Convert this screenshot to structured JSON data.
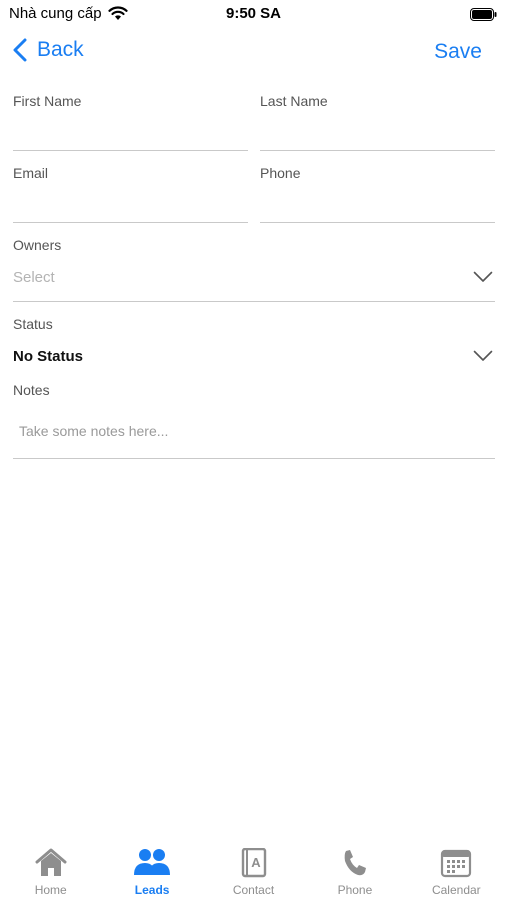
{
  "status_bar": {
    "carrier": "Nhà cung cấp",
    "time": "9:50 SA"
  },
  "nav": {
    "back_label": "Back",
    "save_label": "Save"
  },
  "form": {
    "first_name": {
      "label": "First Name",
      "value": ""
    },
    "last_name": {
      "label": "Last Name",
      "value": ""
    },
    "email": {
      "label": "Email",
      "value": ""
    },
    "phone": {
      "label": "Phone",
      "value": ""
    },
    "owners": {
      "label": "Owners",
      "placeholder": "Select"
    },
    "status": {
      "label": "Status",
      "value": "No Status"
    },
    "notes": {
      "label": "Notes",
      "placeholder": "Take some notes here..."
    }
  },
  "tabs": [
    {
      "label": "Home",
      "icon": "home-icon",
      "active": false
    },
    {
      "label": "Leads",
      "icon": "people-icon",
      "active": true
    },
    {
      "label": "Contact",
      "icon": "contact-book-icon",
      "active": false
    },
    {
      "label": "Phone",
      "icon": "phone-icon",
      "active": false
    },
    {
      "label": "Calendar",
      "icon": "calendar-icon",
      "active": false
    }
  ],
  "colors": {
    "accent": "#1a7ef2",
    "inactive_tab": "#8e8e8e",
    "divider": "#c9c9c9"
  }
}
